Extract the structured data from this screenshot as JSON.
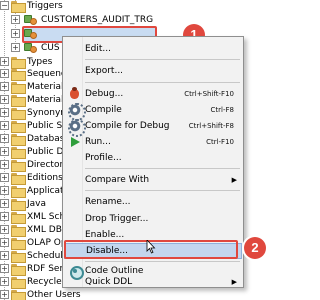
{
  "tree": {
    "items": [
      {
        "label": "Triggers",
        "icon": "folder-icon"
      },
      {
        "label": "CUSTOMERS_AUDIT_TRG",
        "icon": "trigger-icon"
      },
      {
        "label": "",
        "icon": "trigger-icon"
      },
      {
        "label": "CUS",
        "icon": "trigger-icon"
      },
      {
        "label": "Types",
        "icon": "folder-icon"
      },
      {
        "label": "Sequenc",
        "icon": "folder-icon"
      },
      {
        "label": "Materiali",
        "icon": "folder-icon"
      },
      {
        "label": "Materiali",
        "icon": "folder-icon"
      },
      {
        "label": "Synonyn",
        "icon": "folder-icon"
      },
      {
        "label": "Public Sy",
        "icon": "folder-icon"
      },
      {
        "label": "Databas",
        "icon": "folder-icon"
      },
      {
        "label": "Public Da",
        "icon": "folder-icon"
      },
      {
        "label": "Directori",
        "icon": "folder-icon"
      },
      {
        "label": "Editions",
        "icon": "folder-icon"
      },
      {
        "label": "Applicati",
        "icon": "folder-icon"
      },
      {
        "label": "Java",
        "icon": "folder-icon"
      },
      {
        "label": "XML Sch",
        "icon": "folder-icon"
      },
      {
        "label": "XML DB",
        "icon": "folder-icon"
      },
      {
        "label": "OLAP Op",
        "icon": "folder-icon"
      },
      {
        "label": "Schedule",
        "icon": "folder-icon"
      },
      {
        "label": "RDF Sem",
        "icon": "folder-icon"
      },
      {
        "label": "Recycle",
        "icon": "folder-icon"
      },
      {
        "label": "Other Users",
        "icon": "folder-icon"
      }
    ]
  },
  "callouts": [
    {
      "number": "1",
      "color": "#e0483e"
    },
    {
      "number": "2",
      "color": "#e0483e"
    }
  ],
  "menu": {
    "items": [
      {
        "label": "Edit...",
        "shortcut": "",
        "icon": ""
      },
      {
        "label": "Export...",
        "shortcut": "",
        "icon": ""
      },
      {
        "label": "Debug...",
        "shortcut": "Ctrl+Shift-F10",
        "icon": "debug-icon"
      },
      {
        "label": "Compile",
        "shortcut": "Ctrl-F8",
        "icon": "compile-gear-icon"
      },
      {
        "label": "Compile for Debug",
        "shortcut": "Ctrl+Shift-F8",
        "icon": "compile-debug-gear-icon"
      },
      {
        "label": "Run...",
        "shortcut": "Ctrl-F10",
        "icon": "run-icon"
      },
      {
        "label": "Profile...",
        "shortcut": "",
        "icon": ""
      },
      {
        "label": "Compare With",
        "shortcut": "",
        "icon": "",
        "submenu": true
      },
      {
        "label": "Rename...",
        "shortcut": "",
        "icon": ""
      },
      {
        "label": "Drop Trigger...",
        "shortcut": "",
        "icon": ""
      },
      {
        "label": "Enable...",
        "shortcut": "",
        "icon": ""
      },
      {
        "label": "Disable...",
        "shortcut": "",
        "icon": "",
        "highlighted": true
      },
      {
        "label": "Code Outline",
        "shortcut": "",
        "icon": "code-outline-icon"
      },
      {
        "label": "Quick DDL",
        "shortcut": "",
        "icon": "",
        "submenu": true
      }
    ],
    "submenu_arrow": "▶"
  },
  "colors": {
    "callout": "#e0483e",
    "selection": "#c9dcf2",
    "menu_highlight": "#c3d6ee"
  }
}
